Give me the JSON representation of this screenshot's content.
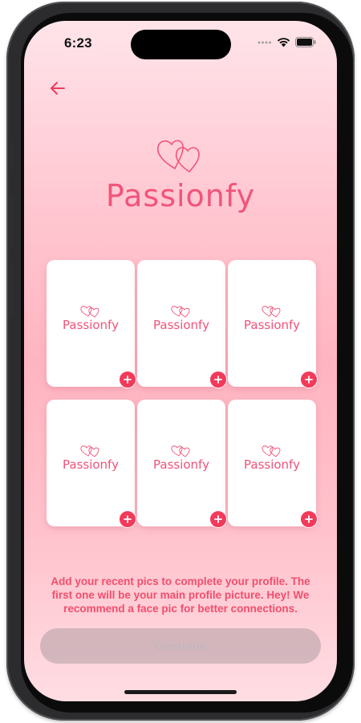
{
  "status_bar": {
    "time": "6:23"
  },
  "header": {
    "back_icon": "arrow-left-icon"
  },
  "brand": {
    "name": "Passionfy",
    "icon": "hearts-icon",
    "color": "#f2547a"
  },
  "photo_slots": [
    {
      "placeholder": "Passionfy",
      "add_icon": "plus-icon"
    },
    {
      "placeholder": "Passionfy",
      "add_icon": "plus-icon"
    },
    {
      "placeholder": "Passionfy",
      "add_icon": "plus-icon"
    },
    {
      "placeholder": "Passionfy",
      "add_icon": "plus-icon"
    },
    {
      "placeholder": "Passionfy",
      "add_icon": "plus-icon"
    },
    {
      "placeholder": "Passionfy",
      "add_icon": "plus-icon"
    }
  ],
  "hint_text": "Add your recent pics to complete your profile. The first one will be your main profile picture. Hey! We recommend a face pic for better connections.",
  "continue_button": {
    "label": "Continue",
    "enabled": false
  },
  "colors": {
    "accent": "#f23a5b",
    "hint": "#f24e6d"
  }
}
